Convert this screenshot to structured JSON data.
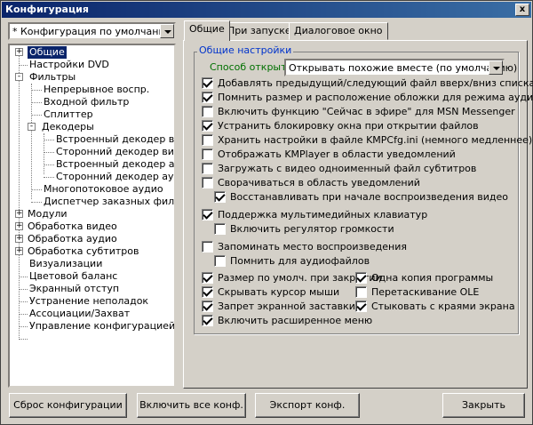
{
  "window": {
    "title": "Конфигурация",
    "close_label": "x"
  },
  "profile_combo": {
    "value": "* Конфигурация по умолчанию"
  },
  "tree": [
    {
      "label": "Общие",
      "level": 0,
      "expander": "+",
      "selected": true
    },
    {
      "label": "Настройки DVD",
      "level": 0
    },
    {
      "label": "Фильтры",
      "level": 0,
      "expander": "-"
    },
    {
      "label": "Непрерывное воспр.",
      "level": 1
    },
    {
      "label": "Входной фильтр",
      "level": 1
    },
    {
      "label": "Сплиттер",
      "level": 1
    },
    {
      "label": "Декодеры",
      "level": 1,
      "expander": "-"
    },
    {
      "label": "Встроенный декодер видео",
      "level": 2
    },
    {
      "label": "Сторонний декодер видео",
      "level": 2
    },
    {
      "label": "Встроенный декодер аудио",
      "level": 2
    },
    {
      "label": "Сторонний декодер аудио",
      "level": 2
    },
    {
      "label": "Многопотоковое аудио",
      "level": 1
    },
    {
      "label": "Диспетчер заказных фильтров",
      "level": 1
    },
    {
      "label": "Модули",
      "level": 0,
      "expander": "+"
    },
    {
      "label": "Обработка видео",
      "level": 0,
      "expander": "+"
    },
    {
      "label": "Обработка аудио",
      "level": 0,
      "expander": "+"
    },
    {
      "label": "Обработка субтитров",
      "level": 0,
      "expander": "+"
    },
    {
      "label": "Визуализации",
      "level": 0
    },
    {
      "label": "Цветовой баланс",
      "level": 0
    },
    {
      "label": "Экранный отступ",
      "level": 0
    },
    {
      "label": "Устранение неполадок",
      "level": 0
    },
    {
      "label": "Ассоциации/Захват",
      "level": 0
    },
    {
      "label": "Управление конфигурацией",
      "level": 0
    }
  ],
  "tabs": [
    {
      "label": "Общие",
      "active": true
    },
    {
      "label": "При запуске..."
    },
    {
      "label": "Диалоговое окно"
    }
  ],
  "group": {
    "title": "Общие настройки",
    "open_method_label": "Способ открытия:",
    "open_method_value": "Открывать похожие вместе (по умолчанию)"
  },
  "options": [
    {
      "label": "Добавлять предыдущий/следующий файл вверх/вниз списка",
      "checked": true
    },
    {
      "label": "Помнить размер и расположение обложки для режима аудио",
      "checked": true
    },
    {
      "label": "Включить функцию \"Сейчас в эфире\" для MSN Messenger",
      "checked": false
    },
    {
      "label": "Устранить блокировку окна при открытии файлов",
      "checked": true
    },
    {
      "label": "Хранить настройки в файле KMPCfg.ini (немного медленнее)",
      "checked": false
    },
    {
      "label": "Отображать KMPlayer в области уведомлений",
      "checked": false
    },
    {
      "label": "Загружать с видео одноименный файл субтитров",
      "checked": false
    },
    {
      "label": "Сворачиваться в область уведомлений",
      "checked": false
    },
    {
      "label": "Восстанавливать при начале воспроизведения видео",
      "checked": true
    },
    {
      "label": "Поддержка мультимедийных клавиатур",
      "checked": true
    },
    {
      "label": "Включить регулятор громкости",
      "checked": false
    },
    {
      "label": "Запоминать место воспроизведения",
      "checked": false
    },
    {
      "label": "Помнить для аудиофайлов",
      "checked": false
    },
    {
      "label": "Размер по умолч. при закрытии",
      "checked": true
    },
    {
      "label": "Скрывать курсор мыши",
      "checked": true
    },
    {
      "label": "Запрет экранной заставки",
      "checked": true
    },
    {
      "label": "Включить расширенное меню",
      "checked": true
    },
    {
      "label": "Одна копия программы",
      "checked": true
    },
    {
      "label": "Перетаскивание OLE",
      "checked": false
    },
    {
      "label": "Стыковать с краями экрана",
      "checked": true
    }
  ],
  "buttons": {
    "reset": "Сброс конфигурации",
    "enable_all": "Включить все конф.",
    "export": "Экспорт конф.",
    "close": "Закрыть"
  }
}
